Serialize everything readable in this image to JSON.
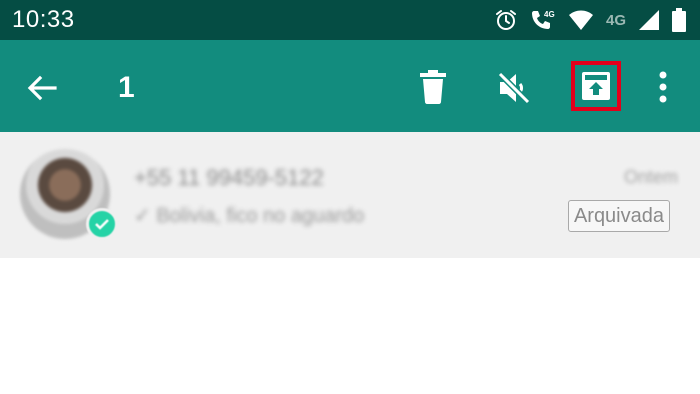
{
  "status_bar": {
    "time": "10:33",
    "network_label": "4G",
    "icons": [
      "alarm-icon",
      "volte-call-icon",
      "wifi-icon",
      "signal-icon",
      "battery-icon"
    ]
  },
  "app_bar": {
    "background": "#128c7e",
    "selected_count": "1",
    "actions": [
      "back-arrow-icon",
      "trash-icon",
      "mute-icon",
      "archive-icon",
      "more-vert-icon"
    ],
    "highlight_color": "#e3001b"
  },
  "chat": {
    "name": "+55 11 99459-5122",
    "last_message": "✓ Bolivia, fico no aguardo",
    "time": "Ontem",
    "badge": "Arquivada"
  }
}
